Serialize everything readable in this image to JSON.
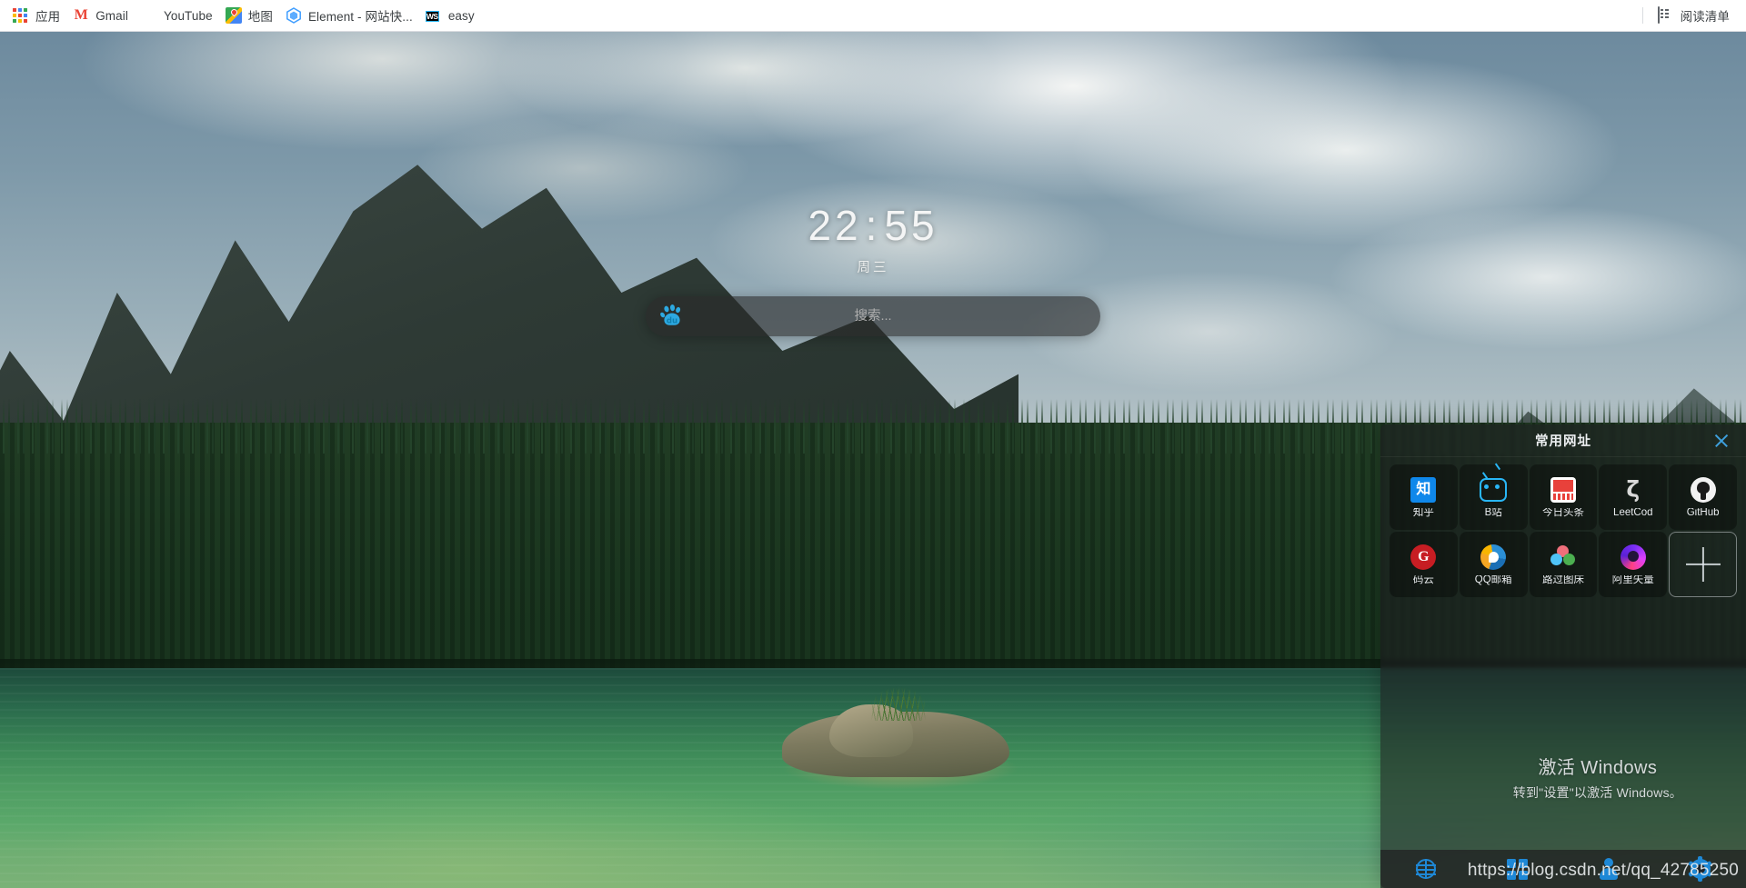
{
  "browser": {
    "bookmarks": [
      {
        "label": "应用",
        "icon": "apps-grid-icon"
      },
      {
        "label": "Gmail",
        "icon": "gmail-icon"
      },
      {
        "label": "YouTube",
        "icon": "youtube-icon"
      },
      {
        "label": "地图",
        "icon": "google-maps-icon"
      },
      {
        "label": "Element - 网站快...",
        "icon": "element-icon"
      },
      {
        "label": "easy",
        "icon": "webstorm-icon"
      }
    ],
    "reading_list": {
      "label": "阅读清单",
      "icon": "reading-list-icon"
    }
  },
  "newtab": {
    "clock": {
      "hours": "22",
      "separator": ":",
      "minutes": "55",
      "weekday": "周三"
    },
    "search": {
      "engine": "baidu",
      "engine_icon": "baidu-paw-icon",
      "value": "",
      "placeholder": "搜索..."
    },
    "favorites_panel": {
      "title": "常用网址",
      "close_icon": "close-icon",
      "add_label": "+",
      "items": [
        {
          "name": "知乎",
          "icon": "zhihu-icon",
          "color": "#0f88eb"
        },
        {
          "name": "B站",
          "icon": "bilibili-icon",
          "color": "#29b6f6"
        },
        {
          "name": "今日头条",
          "icon": "toutiao-icon",
          "color": "#e8413b"
        },
        {
          "name": "LeetCod",
          "icon": "leetcode-icon",
          "color": "#d9d9d9"
        },
        {
          "name": "GitHub",
          "icon": "github-icon",
          "color": "#f2f2f2"
        },
        {
          "name": "码云",
          "icon": "gitee-icon",
          "color": "#c71d23"
        },
        {
          "name": "QQ邮箱",
          "icon": "qqmail-icon",
          "color": "#2b8fd6"
        },
        {
          "name": "路过图床",
          "icon": "tuchuang-icon",
          "color": "#4fc3f7"
        },
        {
          "name": "阿里矢量",
          "icon": "iconfont-icon",
          "color": "#7b2ff7"
        }
      ]
    },
    "bottom_bar": {
      "buttons": [
        {
          "icon": "globe-icon"
        },
        {
          "icon": "apps-grid-icon"
        },
        {
          "icon": "user-icon"
        },
        {
          "icon": "gear-icon"
        }
      ]
    }
  },
  "windows_watermark": {
    "title": "激活 Windows",
    "subtitle": "转到\"设置\"以激活 Windows。"
  },
  "page_watermark": {
    "url": "https://blog.csdn.net/qq_42785250"
  },
  "colors": {
    "accent_blue": "#1e88d6",
    "panel_bg": "rgba(30,30,32,0.58)",
    "bookmark_text": "#3c4043"
  }
}
